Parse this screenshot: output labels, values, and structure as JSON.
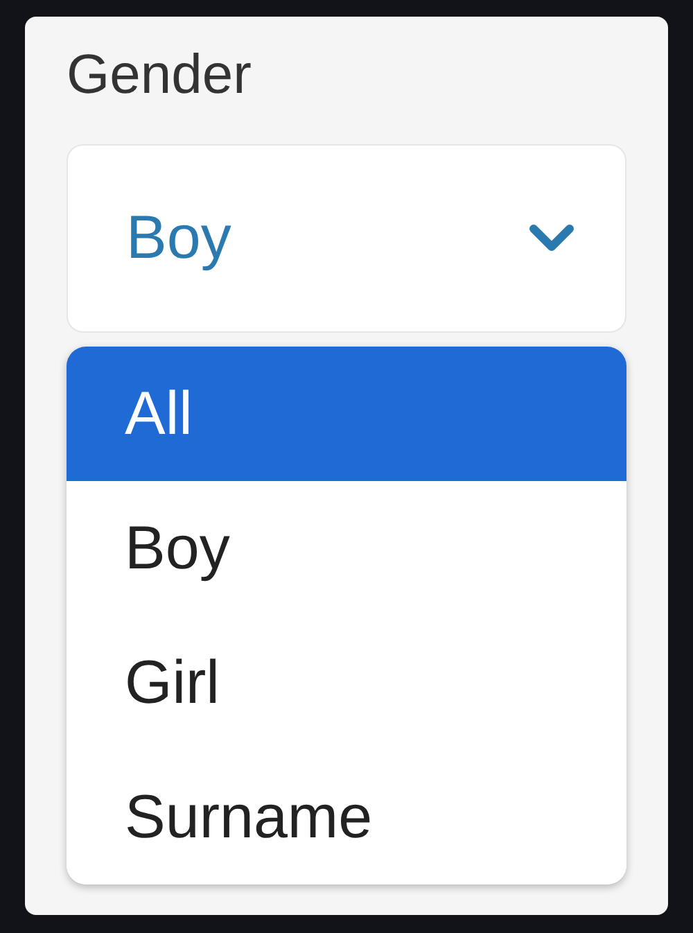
{
  "field": {
    "label": "Gender",
    "value": "Boy",
    "expanded": true
  },
  "options": [
    {
      "label": "All",
      "selected": true
    },
    {
      "label": "Boy",
      "selected": false
    },
    {
      "label": "Girl",
      "selected": false
    },
    {
      "label": "Surname",
      "selected": false
    }
  ]
}
